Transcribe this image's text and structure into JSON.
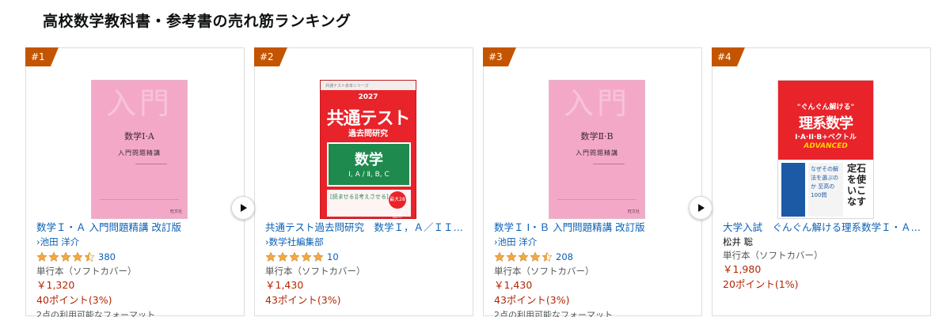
{
  "page": {
    "title": "高校数学教科書・参考書の売れ筋ランキング"
  },
  "colors": {
    "badge": "#c45500",
    "link": "#0b5fb5",
    "price": "#b12704",
    "star": "#f3a847"
  },
  "products": [
    {
      "rank": "#1",
      "title": "数学Ｉ・Ａ 入門問題精講 改訂版",
      "author": "池田 洋介",
      "author_prefix": "›",
      "rating": 4.5,
      "rating_count": "380",
      "format": "単行本（ソフトカバー）",
      "price": "￥1,320",
      "points": "40ポイント(3%)",
      "formats_note": "2点の利用可能なフォーマット",
      "cover": {
        "watermark": "入門",
        "subject": "数学Ⅰ·A",
        "subtitle": "入門問題精講",
        "publisher": "旺文社"
      },
      "has_play": true
    },
    {
      "rank": "#2",
      "title": "共通テスト過去問研究　数学Ｉ，Ａ／ＩＩ，Ｂ，…",
      "author": "数学社編集部",
      "author_prefix": "›",
      "rating": 5,
      "rating_count": "10",
      "format": "単行本（ソフトカバー）",
      "price": "￥1,430",
      "points": "43ポイント(3%)",
      "formats_note": "",
      "cover": {
        "series": "共通テスト赤本シリーズ",
        "year": "2027",
        "title_main": "共通テスト",
        "title_sub": "過去問研究",
        "subject": "数学",
        "range": "Ⅰ, A / Ⅱ, B, C",
        "hand": "[読ませる][考えさせる]",
        "circle": "最大28回分"
      },
      "has_play": false
    },
    {
      "rank": "#3",
      "title": "数学Ｉ I・Ｂ 入門問題精講 改訂版",
      "author": "池田 洋介",
      "author_prefix": "›",
      "rating": 4.5,
      "rating_count": "208",
      "format": "単行本（ソフトカバー）",
      "price": "￥1,430",
      "points": "43ポイント(3%)",
      "formats_note": "2点の利用可能なフォーマット",
      "cover": {
        "watermark": "入門",
        "subject": "数学Ⅱ·B",
        "subtitle": "入門問題精講",
        "publisher": "旺文社"
      },
      "has_play": true
    },
    {
      "rank": "#4",
      "title": "大学入試　ぐんぐん解ける理系数学Ｉ・Ａ・…",
      "author": "松井 聡",
      "author_prefix": "",
      "rating": null,
      "rating_count": "",
      "format": "単行本（ソフトカバー）",
      "price": "￥1,980",
      "points": "20ポイント(1%)",
      "formats_note": "",
      "cover": {
        "phrase": "\"ぐんぐん解ける\"",
        "big": "理系数学",
        "sub": "I·A·II·B+ベクトル",
        "adv": "ADVANCED",
        "mid": "なぜその解法を選ぶのか 至高の100問",
        "right": "定石を使いこなす"
      },
      "has_play": false
    }
  ]
}
